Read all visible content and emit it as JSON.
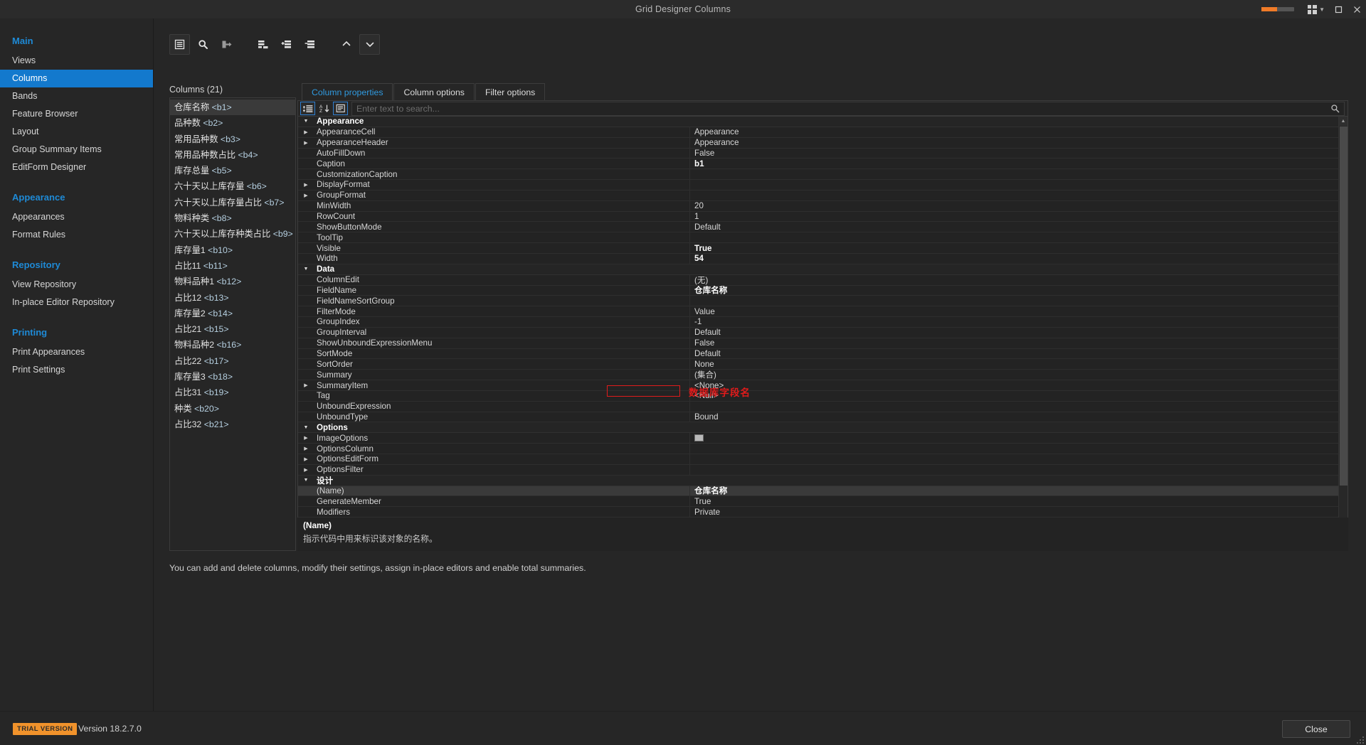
{
  "window": {
    "title": "Grid Designer Columns",
    "minimize_icon": "grid-icon",
    "maximize_icon": "maximize-icon",
    "close_icon": "close-icon"
  },
  "sidebar": {
    "groups": [
      {
        "heading": "Main",
        "items": [
          {
            "label": "Views",
            "active": false
          },
          {
            "label": "Columns",
            "active": true
          },
          {
            "label": "Bands",
            "active": false
          },
          {
            "label": "Feature Browser",
            "active": false
          },
          {
            "label": "Layout",
            "active": false
          },
          {
            "label": "Group Summary Items",
            "active": false
          },
          {
            "label": "EditForm Designer",
            "active": false
          }
        ]
      },
      {
        "heading": "Appearance",
        "items": [
          {
            "label": "Appearances",
            "active": false
          },
          {
            "label": "Format Rules",
            "active": false
          }
        ]
      },
      {
        "heading": "Repository",
        "items": [
          {
            "label": "View Repository",
            "active": false
          },
          {
            "label": "In-place Editor Repository",
            "active": false
          }
        ]
      },
      {
        "heading": "Printing",
        "items": [
          {
            "label": "Print Appearances",
            "active": false
          },
          {
            "label": "Print Settings",
            "active": false
          }
        ]
      }
    ]
  },
  "toolbar": {
    "buttons": [
      {
        "icon": "list-columns-icon",
        "name": "show-columns-button"
      },
      {
        "icon": "search-icon",
        "name": "search-button"
      },
      {
        "icon": "run-designer-icon",
        "name": "retrieve-fields-button"
      },
      {
        "icon": "add-column-icon",
        "name": "add-column-button"
      },
      {
        "icon": "add-field-column-icon",
        "name": "add-field-column-button"
      },
      {
        "icon": "delete-column-icon",
        "name": "delete-column-button"
      },
      {
        "icon": "move-up-icon",
        "name": "move-up-button"
      },
      {
        "icon": "move-down-icon",
        "name": "move-down-button"
      }
    ]
  },
  "columns_panel": {
    "caption": "Columns (21)",
    "items": [
      {
        "name": "仓库名称",
        "tag": "<b1>",
        "selected": true
      },
      {
        "name": "品种数",
        "tag": "<b2>",
        "selected": false
      },
      {
        "name": "常用品种数",
        "tag": "<b3>",
        "selected": false
      },
      {
        "name": "常用品种数占比",
        "tag": "<b4>",
        "selected": false
      },
      {
        "name": "库存总量",
        "tag": "<b5>",
        "selected": false
      },
      {
        "name": "六十天以上库存量",
        "tag": "<b6>",
        "selected": false
      },
      {
        "name": "六十天以上库存量占比",
        "tag": "<b7>",
        "selected": false
      },
      {
        "name": "物料种类",
        "tag": "<b8>",
        "selected": false
      },
      {
        "name": "六十天以上库存种类占比",
        "tag": "<b9>",
        "selected": false
      },
      {
        "name": "库存量1",
        "tag": "<b10>",
        "selected": false
      },
      {
        "name": "占比11",
        "tag": "<b11>",
        "selected": false
      },
      {
        "name": "物料品种1",
        "tag": "<b12>",
        "selected": false
      },
      {
        "name": "占比12",
        "tag": "<b13>",
        "selected": false
      },
      {
        "name": "库存量2",
        "tag": "<b14>",
        "selected": false
      },
      {
        "name": "占比21",
        "tag": "<b15>",
        "selected": false
      },
      {
        "name": "物料品种2",
        "tag": "<b16>",
        "selected": false
      },
      {
        "name": "占比22",
        "tag": "<b17>",
        "selected": false
      },
      {
        "name": "库存量3",
        "tag": "<b18>",
        "selected": false
      },
      {
        "name": "占比31",
        "tag": "<b19>",
        "selected": false
      },
      {
        "name": "种类",
        "tag": "<b20>",
        "selected": false
      },
      {
        "name": "占比32",
        "tag": "<b21>",
        "selected": false
      }
    ]
  },
  "tabs": [
    {
      "label": "Column properties",
      "active": true
    },
    {
      "label": "Column options",
      "active": false
    },
    {
      "label": "Filter options",
      "active": false
    }
  ],
  "property_grid": {
    "toolbar": [
      {
        "icon": "categorized-icon",
        "name": "categorized-button",
        "active": true
      },
      {
        "icon": "alphabetical-icon",
        "name": "alphabetical-button",
        "active": false
      },
      {
        "icon": "description-icon",
        "name": "description-button",
        "active": true
      }
    ],
    "search_placeholder": "Enter text to search...",
    "search_value": "",
    "search_icon": "search-icon",
    "rows": [
      {
        "type": "category",
        "name": "Appearance",
        "value": "",
        "expanded": true
      },
      {
        "type": "prop",
        "name": "AppearanceCell",
        "value": "Appearance",
        "expandable": true
      },
      {
        "type": "prop",
        "name": "AppearanceHeader",
        "value": "Appearance",
        "expandable": true
      },
      {
        "type": "prop",
        "name": "AutoFillDown",
        "value": "False"
      },
      {
        "type": "prop",
        "name": "Caption",
        "value": "b1",
        "bold": true
      },
      {
        "type": "prop",
        "name": "CustomizationCaption",
        "value": ""
      },
      {
        "type": "prop",
        "name": "DisplayFormat",
        "value": "",
        "expandable": true
      },
      {
        "type": "prop",
        "name": "GroupFormat",
        "value": "",
        "expandable": true
      },
      {
        "type": "prop",
        "name": "MinWidth",
        "value": "20"
      },
      {
        "type": "prop",
        "name": "RowCount",
        "value": "1"
      },
      {
        "type": "prop",
        "name": "ShowButtonMode",
        "value": "Default"
      },
      {
        "type": "prop",
        "name": "ToolTip",
        "value": ""
      },
      {
        "type": "prop",
        "name": "Visible",
        "value": "True",
        "bold": true
      },
      {
        "type": "prop",
        "name": "Width",
        "value": "54",
        "bold": true
      },
      {
        "type": "category",
        "name": "Data",
        "value": "",
        "expanded": true
      },
      {
        "type": "prop",
        "name": "ColumnEdit",
        "value": "(无)"
      },
      {
        "type": "prop",
        "name": "FieldName",
        "value": "仓库名称",
        "bold": true,
        "highlighted": true
      },
      {
        "type": "prop",
        "name": "FieldNameSortGroup",
        "value": ""
      },
      {
        "type": "prop",
        "name": "FilterMode",
        "value": "Value"
      },
      {
        "type": "prop",
        "name": "GroupIndex",
        "value": "-1"
      },
      {
        "type": "prop",
        "name": "GroupInterval",
        "value": "Default"
      },
      {
        "type": "prop",
        "name": "ShowUnboundExpressionMenu",
        "value": "False"
      },
      {
        "type": "prop",
        "name": "SortMode",
        "value": "Default"
      },
      {
        "type": "prop",
        "name": "SortOrder",
        "value": "None"
      },
      {
        "type": "prop",
        "name": "Summary",
        "value": "(集合)"
      },
      {
        "type": "prop",
        "name": "SummaryItem",
        "value": "<None>",
        "expandable": true
      },
      {
        "type": "prop",
        "name": "Tag",
        "value": "<Null>"
      },
      {
        "type": "prop",
        "name": "UnboundExpression",
        "value": ""
      },
      {
        "type": "prop",
        "name": "UnboundType",
        "value": "Bound"
      },
      {
        "type": "category",
        "name": "Options",
        "value": "",
        "expanded": true
      },
      {
        "type": "prop",
        "name": "ImageOptions",
        "value": "",
        "expandable": true,
        "swatch": true
      },
      {
        "type": "prop",
        "name": "OptionsColumn",
        "value": "",
        "expandable": true
      },
      {
        "type": "prop",
        "name": "OptionsEditForm",
        "value": "",
        "expandable": true
      },
      {
        "type": "prop",
        "name": "OptionsFilter",
        "value": "",
        "expandable": true
      },
      {
        "type": "category",
        "name": "设计",
        "value": "",
        "expanded": true
      },
      {
        "type": "prop",
        "name": "(Name)",
        "value": "仓库名称",
        "bold": true,
        "selected": true
      },
      {
        "type": "prop",
        "name": "GenerateMember",
        "value": "True"
      },
      {
        "type": "prop",
        "name": "Modifiers",
        "value": "Private"
      }
    ],
    "annotation": "数据库字段名",
    "annotation_color": "#e01b1b",
    "description": {
      "title": "(Name)",
      "text": "指示代码中用来标识该对象的名称。"
    }
  },
  "hint_text": "You can add and delete columns, modify their settings, assign in-place editors and enable total summaries.",
  "footer": {
    "trial_badge": "TRIAL VERSION",
    "version": "Version 18.2.7.0",
    "close_button": "Close"
  },
  "colors": {
    "accent": "#1379cd",
    "heading": "#1e8ad6",
    "tab_active": "#2f9ae0",
    "annotation": "#e01b1b",
    "trial": "#f0922b"
  }
}
